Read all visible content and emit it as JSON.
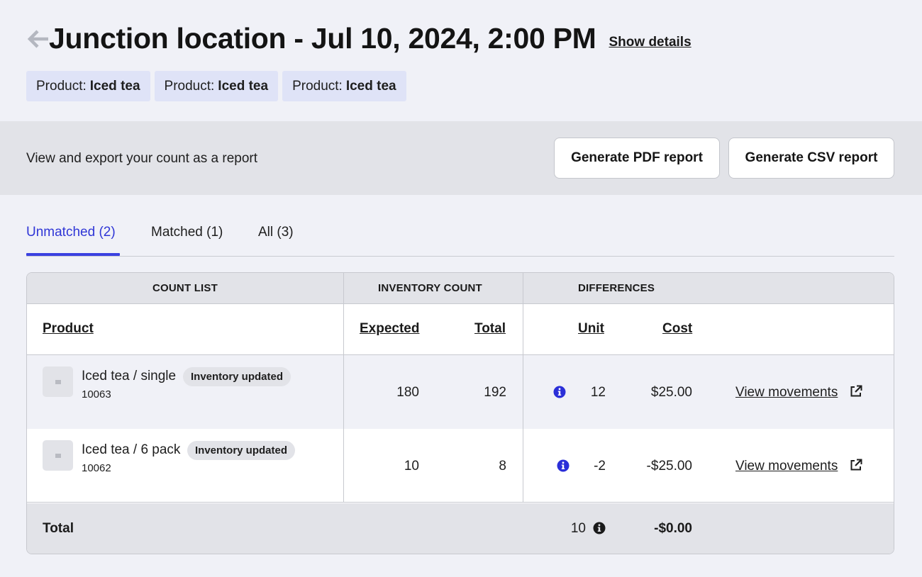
{
  "header": {
    "title": "Junction location - Jul 10, 2024, 2:00 PM",
    "show_details": "Show details"
  },
  "filters": [
    {
      "label": "Product:",
      "value": "Iced tea"
    },
    {
      "label": "Product:",
      "value": "Iced tea"
    },
    {
      "label": "Product:",
      "value": "Iced tea"
    }
  ],
  "report": {
    "text": "View and export your count as a report",
    "pdf_button": "Generate PDF report",
    "csv_button": "Generate CSV report"
  },
  "tabs": [
    {
      "label": "Unmatched (2)",
      "active": true
    },
    {
      "label": "Matched (1)",
      "active": false
    },
    {
      "label": "All (3)",
      "active": false
    }
  ],
  "table": {
    "groups": [
      "COUNT LIST",
      "INVENTORY COUNT",
      "DIFFERENCES"
    ],
    "columns": {
      "product": "Product",
      "expected": "Expected",
      "total": "Total",
      "unit": "Unit",
      "cost": "Cost"
    },
    "rows": [
      {
        "name": "Iced tea / single",
        "badge": "Inventory updated",
        "sku": "10063",
        "expected": "180",
        "total": "192",
        "unit": "12",
        "cost": "$25.00",
        "link": "View movements"
      },
      {
        "name": "Iced tea / 6 pack",
        "badge": "Inventory updated",
        "sku": "10062",
        "expected": "10",
        "total": "8",
        "unit": "-2",
        "cost": "-$25.00",
        "link": "View movements"
      }
    ],
    "footer": {
      "label": "Total",
      "unit": "10",
      "cost": "-$0.00"
    }
  },
  "colors": {
    "accent": "#3a40e0",
    "info_icon": "#2b2fd8",
    "chip_bg": "#dfe3f7",
    "page_bg": "#f0f1f7"
  },
  "icons": {
    "back": "arrow-left-icon",
    "info": "info-circle-icon",
    "external": "external-link-icon",
    "thumbnail": "image-placeholder-icon"
  }
}
